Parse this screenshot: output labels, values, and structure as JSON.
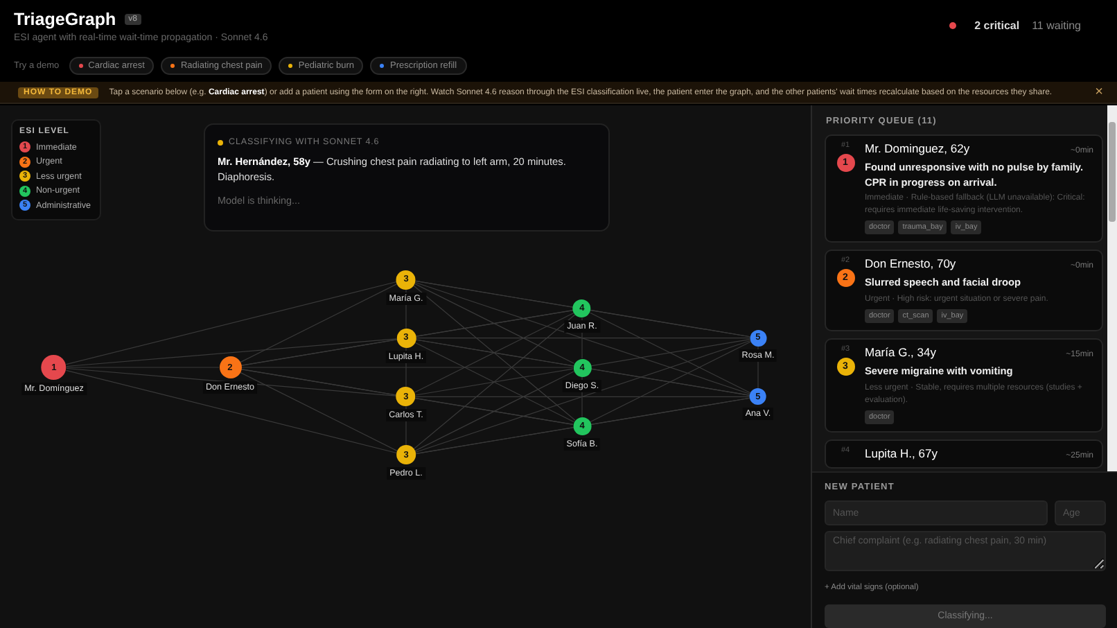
{
  "header": {
    "title": "TriageGraph",
    "version": "v8",
    "subtitle": "ESI agent with real-time wait-time propagation · Sonnet 4.6",
    "critical": "2 critical",
    "waiting": "11 waiting"
  },
  "demos": {
    "label": "Try a demo",
    "items": [
      {
        "label": "Cardiac arrest",
        "color": "#e5484d"
      },
      {
        "label": "Radiating chest pain",
        "color": "#f97316"
      },
      {
        "label": "Pediatric burn",
        "color": "#eab308"
      },
      {
        "label": "Prescription refill",
        "color": "#3b82f6"
      }
    ]
  },
  "banner": {
    "badge": "HOW TO DEMO",
    "text": "Tap a scenario below (e.g. **Cardiac arrest**) or add a patient using the form on the right. Watch Sonnet 4.6 reason through the ESI classification live, the patient enter the graph, and the other patients' wait times recalculate based on the resources they share.",
    "close": "×"
  },
  "legend": {
    "title": "ESI LEVEL",
    "items": [
      {
        "level": "1",
        "label": "Immediate",
        "color": "#e5484d"
      },
      {
        "level": "2",
        "label": "Urgent",
        "color": "#f97316"
      },
      {
        "level": "3",
        "label": "Less urgent",
        "color": "#eab308"
      },
      {
        "level": "4",
        "label": "Non-urgent",
        "color": "#22c55e"
      },
      {
        "level": "5",
        "label": "Administrative",
        "color": "#3b82f6"
      }
    ]
  },
  "classifying": {
    "title": "CLASSIFYING WITH SONNET 4.6",
    "text": "**Mr. Hernández, 58y** — Crushing chest pain radiating to left arm, 20 minutes. Diaphoresis.",
    "status": "Model is thinking..."
  },
  "graph": {
    "columns": [
      [
        {
          "esi": "1",
          "name": "Mr. Domínguez",
          "color": "#e5484d"
        }
      ],
      [
        {
          "esi": "2",
          "name": "Don Ernesto",
          "color": "#f97316"
        }
      ],
      [
        {
          "esi": "3",
          "name": "María G.",
          "color": "#eab308"
        },
        {
          "esi": "3",
          "name": "Lupita H.",
          "color": "#eab308"
        },
        {
          "esi": "3",
          "name": "Carlos T.",
          "color": "#eab308"
        },
        {
          "esi": "3",
          "name": "Pedro L.",
          "color": "#eab308"
        }
      ],
      [
        {
          "esi": "4",
          "name": "Juan R.",
          "color": "#22c55e"
        },
        {
          "esi": "4",
          "name": "Diego S.",
          "color": "#22c55e"
        },
        {
          "esi": "4",
          "name": "Sofía B.",
          "color": "#22c55e"
        }
      ],
      [
        {
          "esi": "5",
          "name": "Rosa M.",
          "color": "#3b82f6"
        },
        {
          "esi": "5",
          "name": "Ana V.",
          "color": "#3b82f6"
        }
      ]
    ]
  },
  "queue": {
    "title": "PRIORITY QUEUE (11)",
    "cards": [
      {
        "rank": "#1",
        "esi": "1",
        "color": "#e5484d",
        "name": "Mr. Dominguez, 62y",
        "wait": "~0min",
        "complaint": "Found unresponsive with no pulse by family. CPR in progress on arrival.",
        "reason": "Immediate · Rule-based fallback (LLM unavailable): Critical: requires immediate life-saving intervention.",
        "tags": [
          "doctor",
          "trauma_bay",
          "iv_bay"
        ]
      },
      {
        "rank": "#2",
        "esi": "2",
        "color": "#f97316",
        "name": "Don Ernesto, 70y",
        "wait": "~0min",
        "complaint": "Slurred speech and facial droop",
        "reason": "Urgent · High risk: urgent situation or severe pain.",
        "tags": [
          "doctor",
          "ct_scan",
          "iv_bay"
        ]
      },
      {
        "rank": "#3",
        "esi": "3",
        "color": "#eab308",
        "name": "María G., 34y",
        "wait": "~15min",
        "complaint": "Severe migraine with vomiting",
        "reason": "Less urgent · Stable, requires multiple resources (studies + evaluation).",
        "tags": [
          "doctor"
        ]
      },
      {
        "rank": "#4",
        "name": "Lupita H., 67y",
        "wait": "~25min"
      }
    ]
  },
  "form": {
    "title": "NEW PATIENT",
    "name_placeholder": "Name",
    "age_placeholder": "Age",
    "complaint_placeholder": "Chief complaint (e.g. radiating chest pain, 30 min)",
    "vitals_link": "+ Add vital signs (optional)",
    "submit": "Classifying...",
    "disabled": true
  }
}
